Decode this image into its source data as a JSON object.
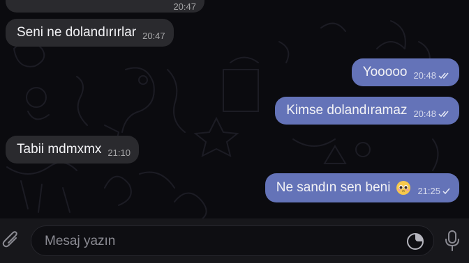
{
  "messages": [
    {
      "text": "",
      "time": "20:47",
      "dir": "in"
    },
    {
      "text": "Seni ne dolandırırlar",
      "time": "20:47",
      "dir": "in"
    },
    {
      "text": "Yooooo",
      "time": "20:48",
      "dir": "out",
      "status": "double-check-icon"
    },
    {
      "text": "Kimse dolandıramaz",
      "time": "20:48",
      "dir": "out",
      "status": "double-check-icon"
    },
    {
      "text": "Tabii mdmxmx",
      "time": "21:10",
      "dir": "in"
    },
    {
      "text": "Ne sandın sen beni",
      "emoji": "pleading-face-emoji",
      "time": "21:25",
      "dir": "out",
      "status": "single-check-icon"
    }
  ],
  "composer": {
    "placeholder": "Mesaj yazın",
    "icons": [
      "attach-icon",
      "sticker-icon",
      "microphone-icon"
    ]
  },
  "colors": {
    "background": "#0b0b0f",
    "incoming_bubble": "#2a2a2e",
    "outgoing_bubble": "#6473b8",
    "composer_bar": "#17171b"
  }
}
